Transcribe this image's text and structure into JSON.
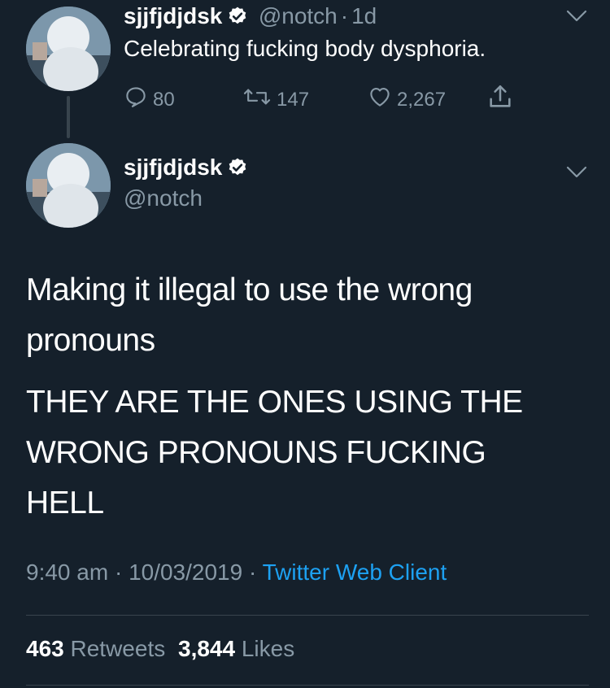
{
  "parent_tweet": {
    "display_name": "sjjfjdjdsk",
    "handle": "@notch",
    "sep": "·",
    "age": "1d",
    "text": "Celebrating fucking body dysphoria.",
    "replies": "80",
    "retweets": "147",
    "likes": "2,267"
  },
  "main_tweet": {
    "display_name": "sjjfjdjdsk",
    "handle": "@notch",
    "paragraph1": "Making it illegal to use the wrong pronouns",
    "paragraph2": "THEY ARE THE ONES USING THE WRONG PRONOUNS FUCKING HELL",
    "time": "9:40 am",
    "sep1": "·",
    "date": "10/03/2019",
    "sep2": "·",
    "client": "Twitter Web Client",
    "retweet_count": "463",
    "retweet_label": "Retweets",
    "like_count": "3,844",
    "like_label": "Likes"
  },
  "colors": {
    "background": "#15202b",
    "muted": "#8899a6",
    "link": "#1da1f2",
    "divider": "#38444d"
  }
}
